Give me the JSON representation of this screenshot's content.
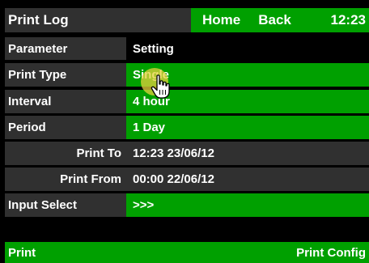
{
  "header": {
    "title": "Print Log",
    "home_label": "Home",
    "back_label": "Back",
    "time": "12:23"
  },
  "table": {
    "column_parameter": "Parameter",
    "column_setting": "Setting",
    "rows": [
      {
        "label": "Print Type",
        "value": "Single"
      },
      {
        "label": "Interval",
        "value": "4 hour"
      },
      {
        "label": "Period",
        "value": "1 Day"
      },
      {
        "label": "Print To",
        "value": "12:23  23/06/12"
      },
      {
        "label": "Print From",
        "value": "00:00  22/06/12"
      },
      {
        "label": "Input Select",
        "value": ">>>"
      }
    ]
  },
  "footer": {
    "print_label": "Print",
    "config_label": "Print Config"
  },
  "colors": {
    "accent_green": "#00a000",
    "dark_gray": "#303030",
    "background": "#000000",
    "touch_indicator": "#e6d23c"
  },
  "cursor": {
    "icon": "hand-pointer-icon"
  }
}
